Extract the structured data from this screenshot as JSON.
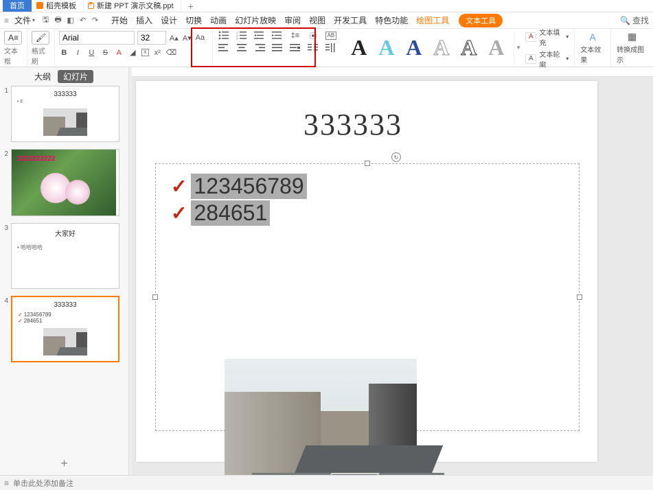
{
  "doctabs": {
    "home": "首页",
    "docke": "稻壳模板",
    "newppt": "新建 PPT 演示文稿.ppt",
    "plus": "+"
  },
  "menu": {
    "file": "文件",
    "items": [
      "开始",
      "插入",
      "设计",
      "切换",
      "动画",
      "幻灯片放映",
      "审阅",
      "视图",
      "开发工具",
      "特色功能"
    ],
    "drawTool": "绘图工具",
    "textTool": "文本工具",
    "search": "查找"
  },
  "ribbon": {
    "textbox": "文本框",
    "format": "格式刷",
    "fontName": "Arial",
    "fontSize": "32",
    "textFill": "文本填充",
    "textOutline": "文本轮廓",
    "textEffect": "文本效果",
    "convert": "转换成图示"
  },
  "panel": {
    "outline": "大纲",
    "slides": "幻灯片",
    "addPlus": "+",
    "thumbs": [
      {
        "num": "1",
        "title": "333333",
        "sub": "E"
      },
      {
        "num": "2",
        "overlay": "2222222222"
      },
      {
        "num": "3",
        "title": "大家好",
        "line1": "哈哈哈哈"
      },
      {
        "num": "4",
        "title": "333333",
        "l1": "123456789",
        "l2": "284651"
      }
    ]
  },
  "slide": {
    "title": "333333",
    "bullets": [
      "123456789",
      "284651"
    ]
  },
  "footer": {
    "notes": "单击此处添加备注"
  }
}
